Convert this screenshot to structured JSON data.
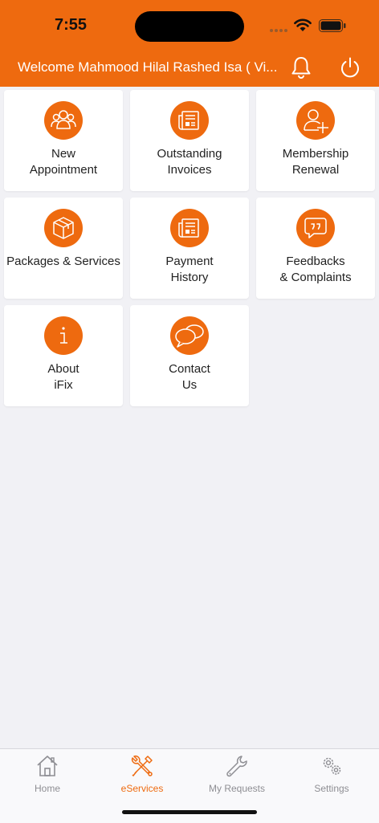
{
  "status_bar": {
    "time": "7:55"
  },
  "header": {
    "welcome_text": "Welcome Mahmood Hilal Rashed Isa ( Vi...",
    "bell_icon": "bell-icon",
    "power_icon": "power-icon"
  },
  "colors": {
    "accent": "#ee6a0f",
    "background": "#f1f1f5",
    "tab_inactive": "#8e8e93"
  },
  "services": [
    {
      "line1": "New",
      "line2": "Appointment",
      "icon": "people-group-icon"
    },
    {
      "line1": "Outstanding",
      "line2": "Invoices",
      "icon": "invoice-icon"
    },
    {
      "line1": "Membership",
      "line2": "Renewal",
      "icon": "user-add-icon"
    },
    {
      "line1": "Packages & Services",
      "line2": "",
      "icon": "package-box-icon"
    },
    {
      "line1": "Payment",
      "line2": "History",
      "icon": "receipt-icon"
    },
    {
      "line1": "Feedbacks",
      "line2": "& Complaints",
      "icon": "feedback-bubble-icon"
    },
    {
      "line1": "About",
      "line2": "iFix",
      "icon": "info-icon"
    },
    {
      "line1": "Contact",
      "line2": "Us",
      "icon": "chat-bubbles-icon"
    }
  ],
  "tabs": [
    {
      "label": "Home",
      "icon": "home-icon",
      "active": false
    },
    {
      "label": "eServices",
      "icon": "tools-icon",
      "active": true
    },
    {
      "label": "My Requests",
      "icon": "wrench-icon",
      "active": false
    },
    {
      "label": "Settings",
      "icon": "gears-icon",
      "active": false
    }
  ]
}
